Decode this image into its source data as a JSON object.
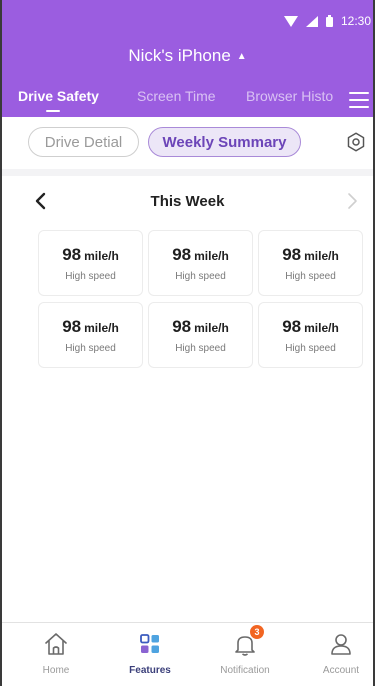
{
  "status": {
    "time": "12:30",
    "icons": [
      "wifi-icon",
      "signal-icon",
      "battery-icon"
    ]
  },
  "header": {
    "device_name": "Nick's iPhone",
    "device_caret": "▲",
    "tabs": [
      {
        "label": "Drive Safety",
        "active": true
      },
      {
        "label": "Screen Time",
        "active": false
      },
      {
        "label": "Browser Histo",
        "active": false
      }
    ]
  },
  "subtabs": {
    "items": [
      {
        "label": "Drive Detial",
        "active": false
      },
      {
        "label": "Weekly Summary",
        "active": true
      }
    ]
  },
  "week": {
    "title": "This Week"
  },
  "stats": [
    {
      "value": "98",
      "unit": "mile/h",
      "label": "High speed"
    },
    {
      "value": "98",
      "unit": "mile/h",
      "label": "High speed"
    },
    {
      "value": "98",
      "unit": "mile/h",
      "label": "High speed"
    },
    {
      "value": "98",
      "unit": "mile/h",
      "label": "High speed"
    },
    {
      "value": "98",
      "unit": "mile/h",
      "label": "High speed"
    },
    {
      "value": "98",
      "unit": "mile/h",
      "label": "High speed"
    }
  ],
  "bottom_nav": {
    "items": [
      {
        "label": "Home",
        "icon": "home-icon",
        "active": false
      },
      {
        "label": "Features",
        "icon": "features-icon",
        "active": true
      },
      {
        "label": "Notification",
        "icon": "bell-icon",
        "active": false,
        "badge": "3"
      },
      {
        "label": "Account",
        "icon": "account-icon",
        "active": false
      }
    ]
  },
  "colors": {
    "brand": "#9b5de0",
    "active_pill_bg": "#ece6f7",
    "active_pill_text": "#6c45b8",
    "badge": "#f26522",
    "nav_active": "#3b3f7a"
  }
}
